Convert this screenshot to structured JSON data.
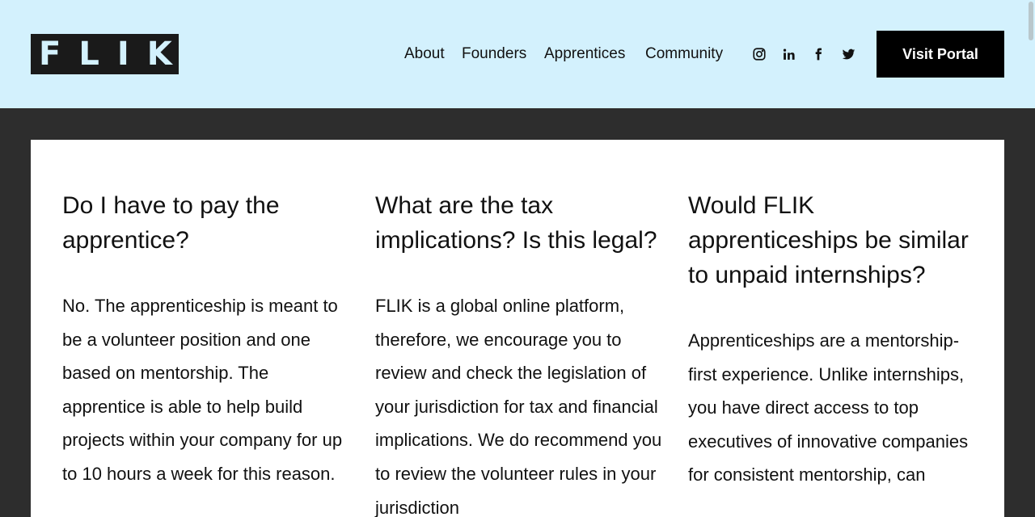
{
  "brand": {
    "logo_text": "FLIK"
  },
  "nav": {
    "items": [
      {
        "label": "About"
      },
      {
        "label": "Founders"
      },
      {
        "label": "Apprentices"
      },
      {
        "label": "Community"
      }
    ]
  },
  "social": [
    {
      "icon": "instagram-icon"
    },
    {
      "icon": "linkedin-icon"
    },
    {
      "icon": "facebook-icon"
    },
    {
      "icon": "twitter-icon"
    }
  ],
  "header_cta": {
    "label": "Visit Portal"
  },
  "colors": {
    "header_bg": "#d3f1fd",
    "page_bg": "#2d2d2d",
    "card_bg": "#ffffff",
    "button_bg": "#000000"
  },
  "faq": [
    {
      "question": "Do I have to pay the apprentice?",
      "answer": "No. The apprenticeship is meant to be a volunteer position and one based on mentorship. The apprentice is able to help build projects within your company for up to 10 hours a week for this reason."
    },
    {
      "question": "What are the tax implications? Is this legal?",
      "answer": "FLIK is a global online platform, therefore, we encourage you to review and check the legislation of your jurisdiction for tax and financial implications. We do recommend you to review the volunteer rules in your jurisdiction"
    },
    {
      "question": "Would FLIK apprenticeships be similar to unpaid internships?",
      "answer": "Apprenticeships are a mentorship-first experience. Unlike internships, you have direct access to top executives of innovative companies for consistent mentorship, can"
    }
  ]
}
